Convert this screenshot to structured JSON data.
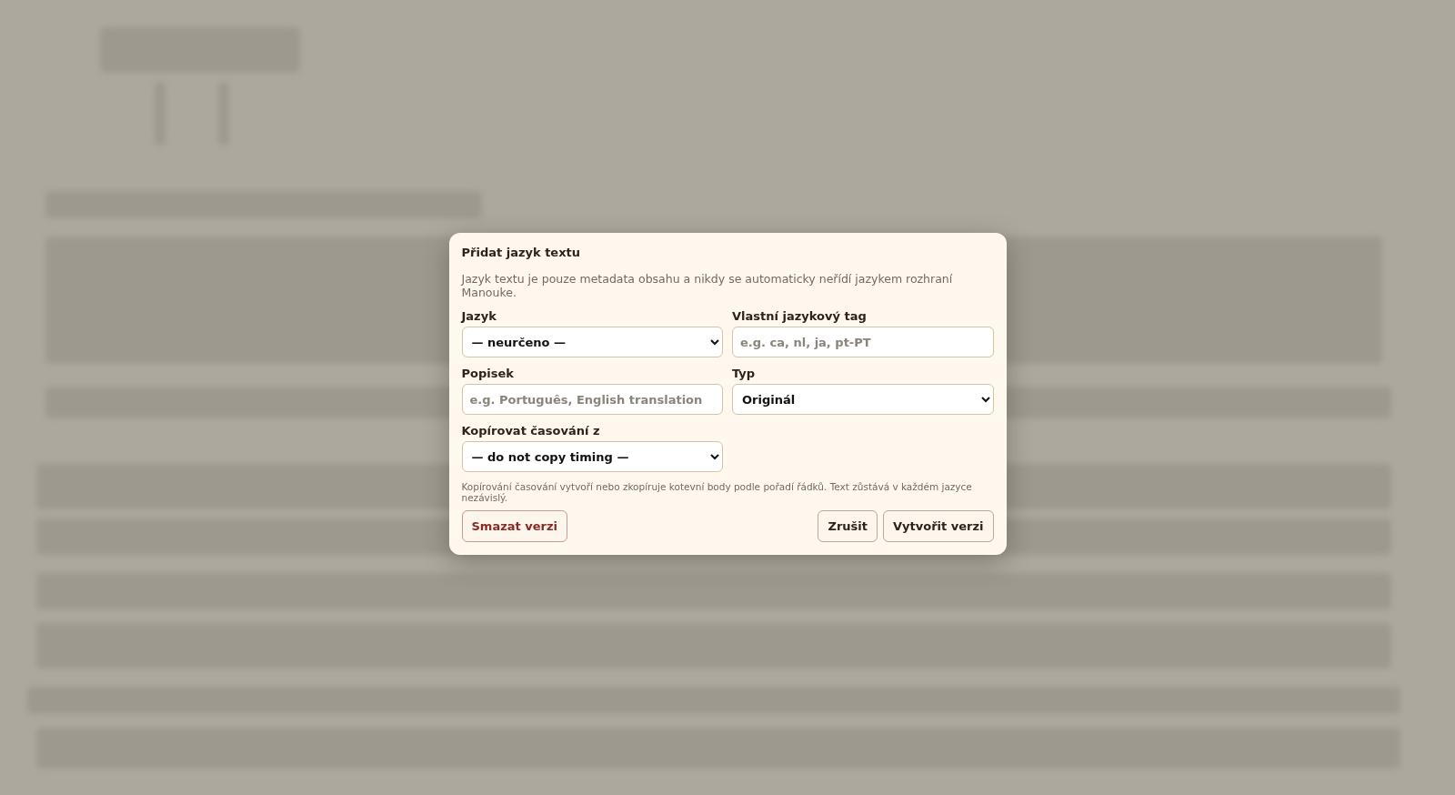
{
  "dialog": {
    "title": "Přidat jazyk textu",
    "description": "Jazyk textu je pouze metadata obsahu a nikdy se automaticky neřídí jazykem rozhraní Manouke.",
    "fields": [
      {
        "kind": "select",
        "label": "Jazyk",
        "value": "— neurčeno —"
      },
      {
        "kind": "input",
        "label": "Vlastní jazykový tag",
        "placeholder": "e.g. ca, nl, ja, pt-PT"
      },
      {
        "kind": "input",
        "label": "Popisek",
        "placeholder": "e.g. Português, English translation"
      },
      {
        "kind": "select",
        "label": "Typ",
        "value": "Originál"
      },
      {
        "kind": "select",
        "label": "Kopírovat časování z",
        "value": "— do not copy timing —"
      }
    ],
    "hint": "Kopírování časování vytvoří nebo zkopíruje kotevní body podle pořadí řádků. Text zůstává v každém jazyce nezávislý.",
    "buttons": [
      {
        "kind": "danger",
        "label": "Smazat verzi"
      },
      {
        "kind": "plain",
        "label": "Zrušit"
      },
      {
        "kind": "plain",
        "label": "Vytvořit verzi"
      }
    ]
  }
}
